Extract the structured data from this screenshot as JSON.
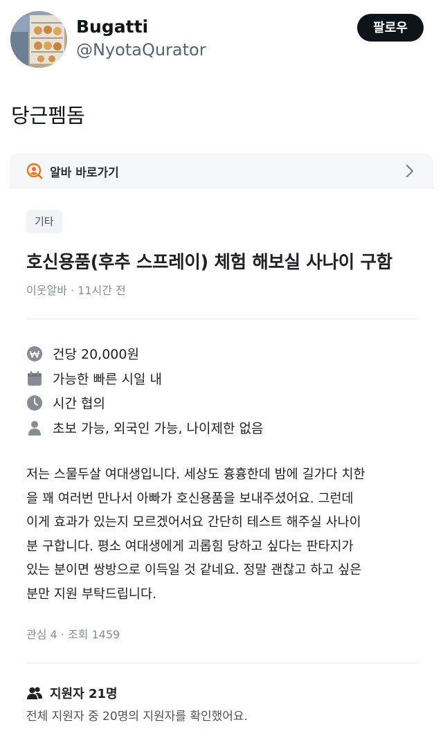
{
  "tweet": {
    "display_name": "Bugatti",
    "handle": "@NyotaQurator",
    "follow_label": "팔로우",
    "text": "당근펨돔"
  },
  "post": {
    "shortcut_label": "알바 바로가기",
    "category": "기타",
    "title": "호신용품(후추 스프레이) 체험 해보실 사나이 구함",
    "meta": "이웃알바 · 11시간 전",
    "info": [
      {
        "icon": "won-icon",
        "text": "건당 20,000원"
      },
      {
        "icon": "calendar-icon",
        "text": "가능한 빠른 시일 내"
      },
      {
        "icon": "clock-icon",
        "text": "시간 협의"
      },
      {
        "icon": "person-icon",
        "text": "초보 가능, 외국인 가능, 나이제한 없음"
      }
    ],
    "description_lines": [
      "저는 스물두살 여대생입니다. 세상도 흉흉한데 밤에 길가다 치한",
      "을 꽤 여러번 만나서 아빠가 호신용품을 보내주셨어요. 그런데",
      "이게 효과가 있는지 모르겠어서요 간단히 테스트 해주실 사나이",
      "분 구합니다. 평소 여대생에게 괴롭힘 당하고 싶다는 판타지가",
      "있는 분이면 쌍방으로 이득일 것 같네요. 정말 괜찮고 하고 싶은",
      "분만 지원 부탁드립니다."
    ],
    "stats": "관심 4 · 조회 1459",
    "applicants_title": "지원자 21명",
    "applicants_sub": "전체 지원자 중 20명의 지원자를 확인했어요."
  },
  "colors": {
    "accent_orange": "#ff6f0f",
    "icon_gray": "#868b94"
  }
}
